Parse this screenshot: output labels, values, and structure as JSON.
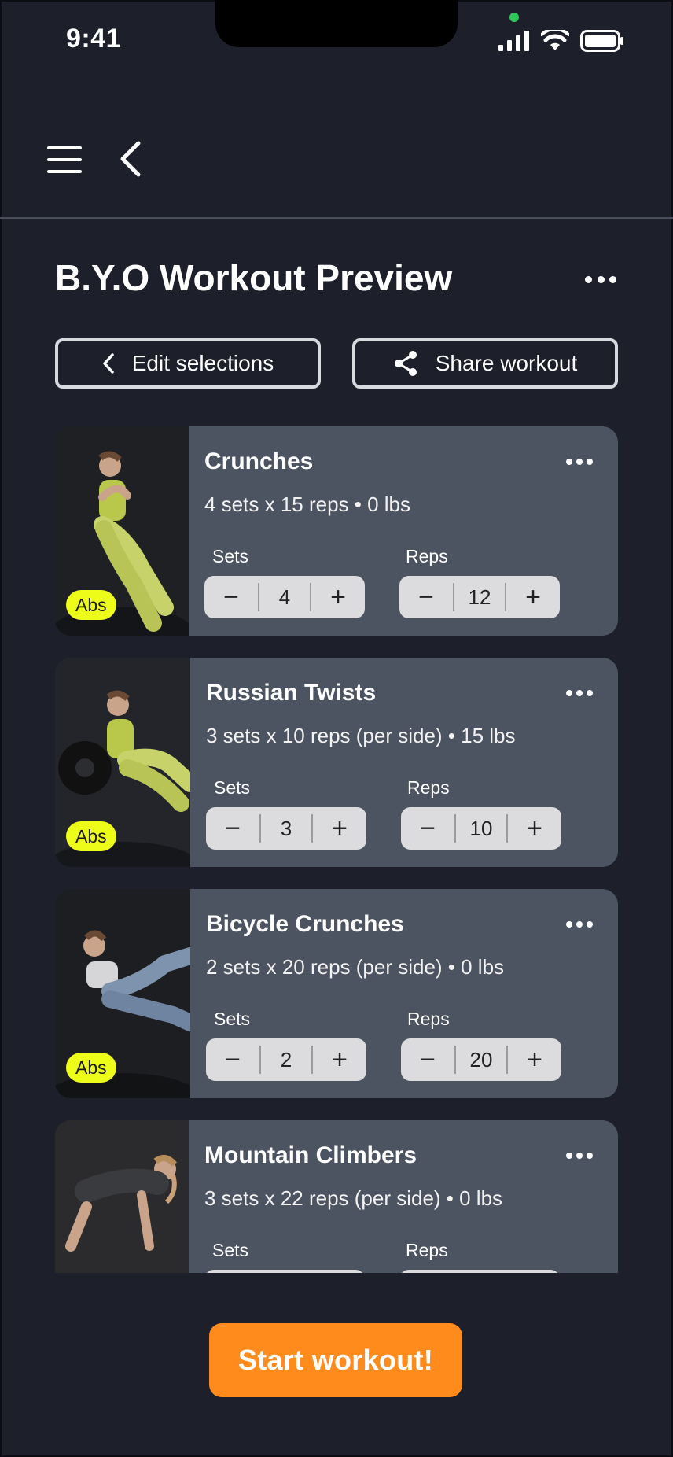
{
  "status_bar": {
    "time": "9:41"
  },
  "page": {
    "title": "B.Y.O Workout Preview"
  },
  "actions": {
    "edit_label": "Edit selections",
    "share_label": "Share workout"
  },
  "labels": {
    "sets": "Sets",
    "reps": "Reps"
  },
  "exercises": [
    {
      "name": "Crunches",
      "summary": "4 sets x 15 reps • 0 lbs",
      "tag": "Abs",
      "sets": "4",
      "reps": "12"
    },
    {
      "name": "Russian Twists",
      "summary": "3 sets x 10 reps (per side) • 15 lbs",
      "tag": "Abs",
      "sets": "3",
      "reps": "10"
    },
    {
      "name": "Bicycle Crunches",
      "summary": "2 sets x 20 reps (per side) • 0 lbs",
      "tag": "Abs",
      "sets": "2",
      "reps": "20"
    },
    {
      "name": "Mountain Climbers",
      "summary": "3 sets x 22 reps (per side) • 0 lbs",
      "tag": "",
      "sets": "",
      "reps": ""
    }
  ],
  "stepper_symbols": {
    "minus": "−",
    "plus": "+"
  },
  "cta": {
    "label": "Start workout!"
  },
  "colors": {
    "background": "#1d1f2b",
    "card": "#4d5461",
    "accent": "#ff8b1c",
    "tag": "#eefc1a"
  }
}
